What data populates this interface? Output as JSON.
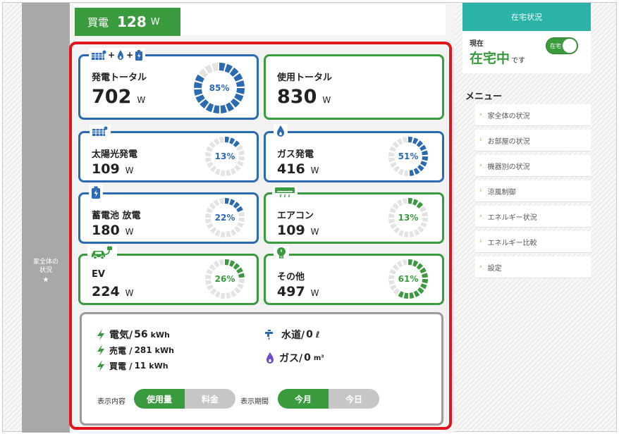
{
  "left_rail": {
    "item_label": "家全体の\n状況",
    "star": "★"
  },
  "header": {
    "buy_label": "買電",
    "buy_value": "128",
    "buy_unit": "W"
  },
  "cards": {
    "gen_total": {
      "title": "発電トータル",
      "value": "702",
      "unit": "W",
      "percent": 85,
      "percent_label": "85%",
      "icon_plus": "+"
    },
    "use_total": {
      "title": "使用トータル",
      "value": "830",
      "unit": "W"
    },
    "solar": {
      "title": "太陽光発電",
      "value": "109",
      "unit": "W",
      "percent": 13,
      "percent_label": "13%"
    },
    "gas": {
      "title": "ガス発電",
      "value": "416",
      "unit": "W",
      "percent": 51,
      "percent_label": "51%"
    },
    "battery": {
      "title": "蓄電池 放電",
      "value": "180",
      "unit": "W",
      "percent": 22,
      "percent_label": "22%"
    },
    "aircon": {
      "title": "エアコン",
      "value": "109",
      "unit": "W",
      "percent": 13,
      "percent_label": "13%"
    },
    "ev": {
      "title": "EV",
      "value": "224",
      "unit": "W",
      "percent": 26,
      "percent_label": "26%"
    },
    "other": {
      "title": "その他",
      "value": "497",
      "unit": "W",
      "percent": 61,
      "percent_label": "61%"
    }
  },
  "summary": {
    "electricity": {
      "label": "電気/",
      "value": "56",
      "unit": "kWh"
    },
    "sold": {
      "label": "売電 /",
      "value": "281",
      "unit": "kWh"
    },
    "bought": {
      "label": "買電 /",
      "value": "11",
      "unit": "kWh"
    },
    "water": {
      "label": "水道/",
      "value": "0",
      "unit": "ℓ"
    },
    "gas": {
      "label": "ガス/",
      "value": "0",
      "unit": "m³"
    },
    "display_content_label": "表示内容",
    "display_content_options": [
      "使用量",
      "料金"
    ],
    "display_period_label": "表示期間",
    "display_period_options": [
      "今月",
      "今日"
    ]
  },
  "right": {
    "status_header": "在宅状況",
    "now_label": "現在",
    "status_text": "在宅中",
    "status_suffix": "です",
    "toggle_label": "在宅",
    "menu_title": "メニュー",
    "menu_items": [
      "家全体の状況",
      "お部屋の状況",
      "機器別の状況",
      "涼風制御",
      "エネルギー状況",
      "エネルギー比較",
      "設定"
    ]
  },
  "colors": {
    "blue": "#2a6ab3",
    "green": "#3a9a3e",
    "red_frame": "#e2141c",
    "teal": "#2bb3a8",
    "ring_track": "#e3e3e3"
  }
}
